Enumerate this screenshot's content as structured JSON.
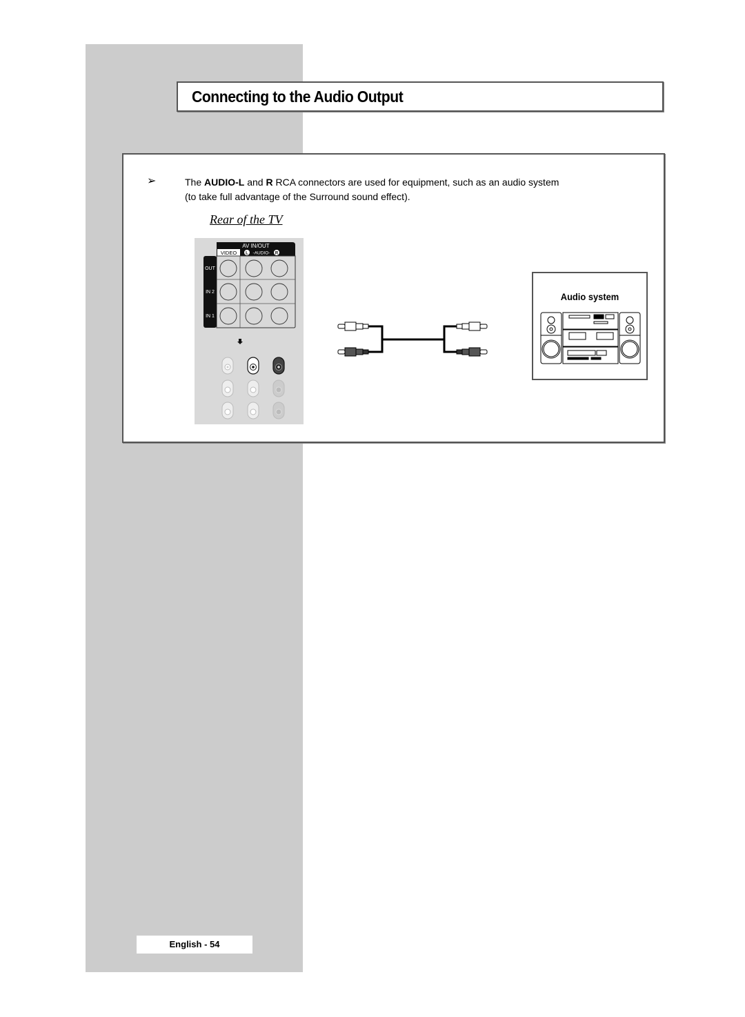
{
  "page": {
    "title": "Connecting to the Audio Output",
    "footer": "English - 54"
  },
  "note": {
    "arrow_icon": "arrow-right-icon",
    "segments": [
      {
        "text": "The ",
        "bold": false
      },
      {
        "text": "AUDIO-L",
        "bold": true
      },
      {
        "text": " and ",
        "bold": false
      },
      {
        "text": "R",
        "bold": true
      },
      {
        "text": " RCA connectors are used for equipment, such as an audio system",
        "bold": false
      }
    ],
    "line2": "(to take full advantage of the Surround sound effect)."
  },
  "diagram": {
    "tv_label": "Rear of the TV",
    "panel": {
      "header": "AV IN/OUT",
      "col_video": "VIDEO",
      "col_audio": "-AUDIO-",
      "audio_left_badge": "L",
      "audio_right_badge": "R",
      "rows": [
        "OUT",
        "IN 2",
        "IN 1"
      ]
    },
    "device_label": "Audio system"
  }
}
